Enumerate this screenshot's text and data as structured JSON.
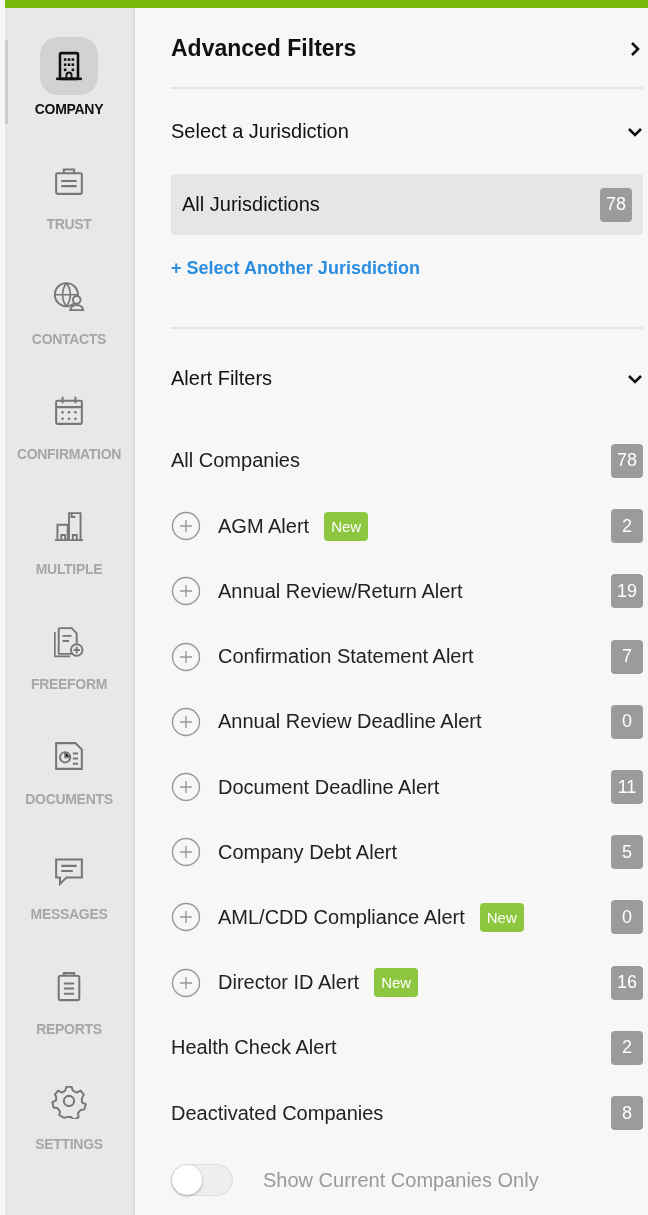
{
  "sidebar": {
    "items": [
      {
        "label": "COMPANY",
        "selected": true
      },
      {
        "label": "TRUST",
        "selected": false
      },
      {
        "label": "CONTACTS",
        "selected": false
      },
      {
        "label": "CONFIRMATION",
        "selected": false
      },
      {
        "label": "MULTIPLE",
        "selected": false
      },
      {
        "label": "FREEFORM",
        "selected": false
      },
      {
        "label": "DOCUMENTS",
        "selected": false
      },
      {
        "label": "MESSAGES",
        "selected": false
      },
      {
        "label": "REPORTS",
        "selected": false
      },
      {
        "label": "SETTINGS",
        "selected": false
      }
    ]
  },
  "panel": {
    "title": "Advanced Filters",
    "expanded": false,
    "jurisdiction": {
      "title": "Select a Jurisdiction",
      "expanded": true,
      "selected_item": {
        "label": "All Jurisdictions",
        "count": "78"
      },
      "add_link": "+ Select Another Jurisdiction"
    },
    "alert_filters": {
      "title": "Alert Filters",
      "expanded": true,
      "items": [
        {
          "kind": "plain",
          "label": "All Companies",
          "count": "78"
        },
        {
          "kind": "expandable",
          "label": "AGM Alert",
          "badge": "New",
          "count": "2"
        },
        {
          "kind": "expandable",
          "label": "Annual Review/Return Alert",
          "count": "19"
        },
        {
          "kind": "expandable",
          "label": "Confirmation Statement Alert",
          "count": "7"
        },
        {
          "kind": "expandable",
          "label": "Annual Review Deadline Alert",
          "count": "0"
        },
        {
          "kind": "expandable",
          "label": "Document Deadline Alert",
          "count": "11"
        },
        {
          "kind": "expandable",
          "label": "Company Debt Alert",
          "count": "5"
        },
        {
          "kind": "expandable",
          "label": "AML/CDD Compliance Alert",
          "badge": "New",
          "count": "0"
        },
        {
          "kind": "expandable",
          "label": "Director ID Alert",
          "badge": "New",
          "count": "16"
        },
        {
          "kind": "plain",
          "label": "Health Check Alert",
          "count": "2"
        },
        {
          "kind": "plain",
          "label": "Deactivated Companies",
          "count": "8"
        }
      ]
    },
    "toggle": {
      "label": "Show Current Companies Only",
      "on": false
    }
  }
}
